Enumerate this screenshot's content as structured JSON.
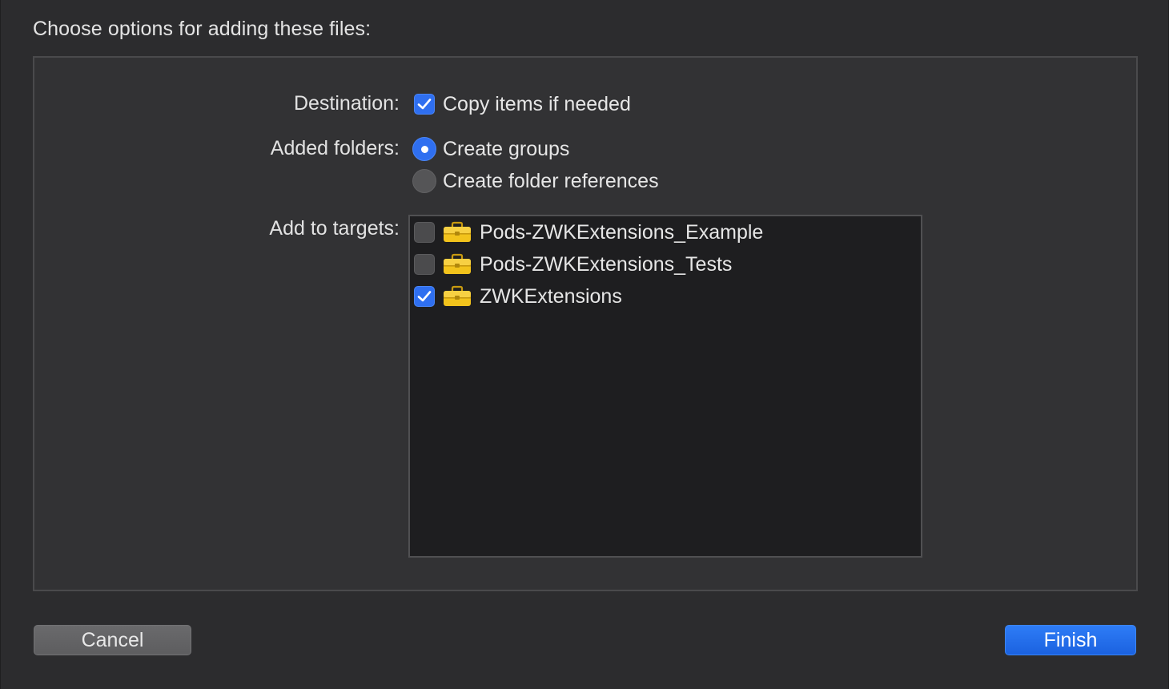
{
  "dialog": {
    "heading": "Choose options for adding these files:"
  },
  "destination": {
    "label": "Destination:",
    "copy_items": {
      "label": "Copy items if needed",
      "checked": true
    }
  },
  "added_folders": {
    "label": "Added folders:",
    "options": [
      {
        "label": "Create groups",
        "selected": true
      },
      {
        "label": "Create folder references",
        "selected": false
      }
    ]
  },
  "targets": {
    "label": "Add to targets:",
    "items": [
      {
        "name": "Pods-ZWKExtensions_Example",
        "checked": false,
        "icon": "toolbox-icon"
      },
      {
        "name": "Pods-ZWKExtensions_Tests",
        "checked": false,
        "icon": "toolbox-icon"
      },
      {
        "name": "ZWKExtensions",
        "checked": true,
        "icon": "toolbox-icon"
      }
    ]
  },
  "buttons": {
    "cancel": "Cancel",
    "finish": "Finish"
  },
  "colors": {
    "accent": "#2f6ff0",
    "toolbox": "#f2c31c"
  }
}
